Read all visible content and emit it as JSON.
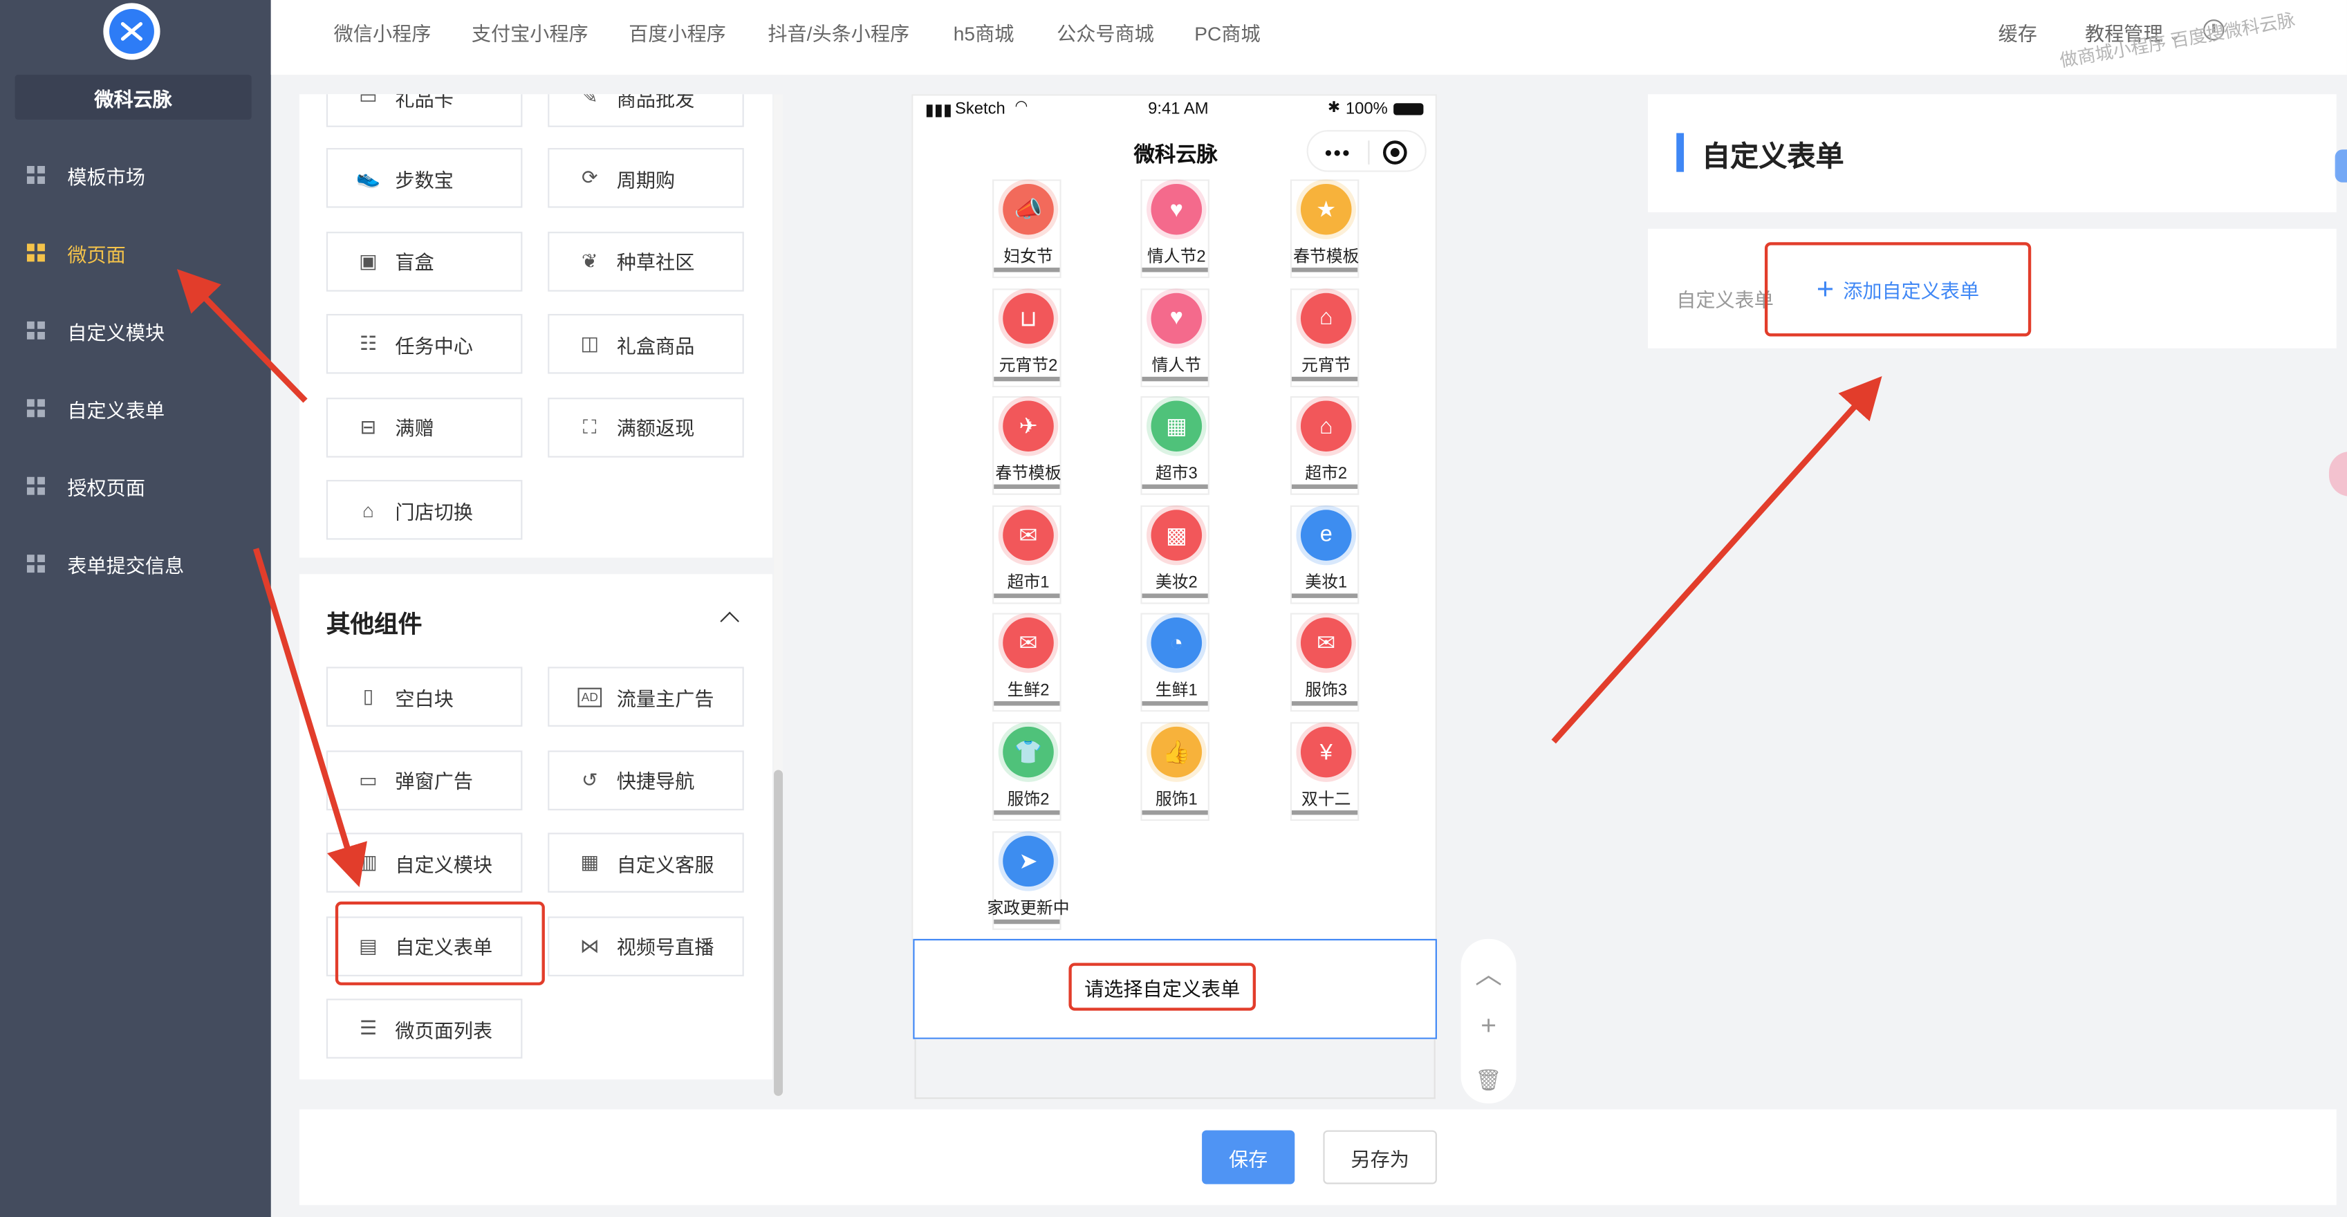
{
  "brand": {
    "name": "微科云脉"
  },
  "sidebar": {
    "items": [
      {
        "label": "模板市场"
      },
      {
        "label": "微页面"
      },
      {
        "label": "自定义模块"
      },
      {
        "label": "自定义表单"
      },
      {
        "label": "授权页面"
      },
      {
        "label": "表单提交信息"
      }
    ],
    "active_index": 1
  },
  "topnav": {
    "tabs": [
      "微信小程序",
      "支付宝小程序",
      "百度小程序",
      "抖音/头条小程序",
      "h5商城",
      "公众号商城",
      "PC商城"
    ],
    "cache": "缓存",
    "tutorial": "教程管理",
    "watermark": "做商城小程序 百度搜微科云脉"
  },
  "panel": {
    "partial_row": [
      "礼品卡",
      "商品批发"
    ],
    "marketing": [
      "步数宝",
      "周期购",
      "盲盒",
      "种草社区",
      "任务中心",
      "礼盒商品",
      "满赠",
      "满额返现",
      "门店切换"
    ],
    "other_title": "其他组件",
    "other": [
      "空白块",
      "流量主广告",
      "弹窗广告",
      "快捷导航",
      "自定义模块",
      "自定义客服",
      "自定义表单",
      "视频号直播",
      "微页面列表"
    ]
  },
  "phone": {
    "carrier": "Sketch",
    "time": "9:41 AM",
    "battery": "100%",
    "title": "微科云脉",
    "templates": [
      {
        "label": "妇女节",
        "color": "#f26a5b",
        "icon": "megaphone-icon"
      },
      {
        "label": "情人节2",
        "color": "#f46a8c",
        "icon": "heart-icon"
      },
      {
        "label": "春节模板",
        "color": "#f7b23b",
        "icon": "star-icon"
      },
      {
        "label": "元宵节2",
        "color": "#f2575a",
        "icon": "bag-icon"
      },
      {
        "label": "情人节",
        "color": "#f46a8c",
        "icon": "heart-icon"
      },
      {
        "label": "元宵节",
        "color": "#f2575a",
        "icon": "basket-icon"
      },
      {
        "label": "春节模板",
        "color": "#f2575a",
        "icon": "pin-icon"
      },
      {
        "label": "超市3",
        "color": "#4fc27a",
        "icon": "train-icon"
      },
      {
        "label": "超市2",
        "color": "#f2575a",
        "icon": "basket-icon"
      },
      {
        "label": "超市1",
        "color": "#f2575a",
        "icon": "envelope-icon"
      },
      {
        "label": "美妆2",
        "color": "#f2575a",
        "icon": "apps-icon"
      },
      {
        "label": "美妆1",
        "color": "#3d8df0",
        "icon": "e-icon"
      },
      {
        "label": "生鲜2",
        "color": "#f2575a",
        "icon": "envelope-icon"
      },
      {
        "label": "生鲜1",
        "color": "#3d8df0",
        "icon": "stroller-icon"
      },
      {
        "label": "服饰3",
        "color": "#f2575a",
        "icon": "envelope-icon"
      },
      {
        "label": "服饰2",
        "color": "#4fc27a",
        "icon": "shirt-icon"
      },
      {
        "label": "服饰1",
        "color": "#f7b23b",
        "icon": "thumb-icon"
      },
      {
        "label": "双十二",
        "color": "#f2575a",
        "icon": "redpacket-icon"
      },
      {
        "label": "家政更新中",
        "color": "#3d8df0",
        "icon": "send-icon"
      }
    ],
    "choose_form": "请选择自定义表单"
  },
  "right": {
    "title": "自定义表单",
    "field_label": "自定义表单",
    "add_button": "添加自定义表单"
  },
  "footer": {
    "save": "保存",
    "save_as": "另存为"
  },
  "colors": {
    "sidebar_bg": "#444c5e",
    "active": "#f5c34a",
    "primary": "#3f87f5",
    "annotation": "#e23d2b"
  }
}
